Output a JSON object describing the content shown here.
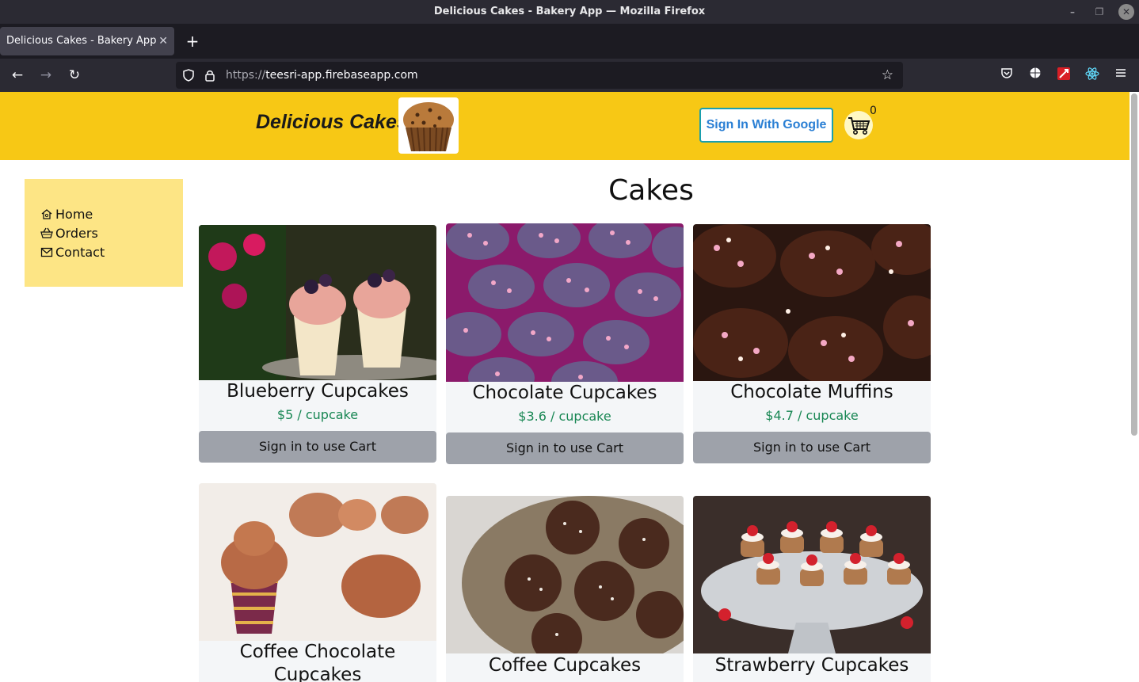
{
  "window": {
    "title": "Delicious Cakes - Bakery App — Mozilla Firefox",
    "minimize": "–",
    "restore": "❐",
    "close": "✕"
  },
  "tabs": [
    {
      "label": "Delicious Cakes - Bakery App",
      "close": "✕"
    }
  ],
  "new_tab": "+",
  "nav": {
    "back": "←",
    "forward": "→",
    "reload": "↻",
    "shield": "⛉",
    "lock": "🔒",
    "url_scheme": "https://",
    "url_host": "teesri-app.firebaseapp.com",
    "bookmark": "☆"
  },
  "toolbar": {
    "pocket": "◡",
    "globe": "◍",
    "ext1": "✦",
    "react": "⚛",
    "menu": "≡"
  },
  "header": {
    "brand": "Delicious Cakes",
    "signin_label": "Sign In With Google",
    "cart_count": "0"
  },
  "sidebar": {
    "items": [
      {
        "label": "Home",
        "icon": "home-icon"
      },
      {
        "label": "Orders",
        "icon": "basket-icon"
      },
      {
        "label": "Contact",
        "icon": "envelope-icon"
      }
    ]
  },
  "main": {
    "title": "Cakes",
    "products": [
      {
        "name": "Blueberry Cupcakes",
        "price": "$5 / cupcake",
        "button": "Sign in to use Cart"
      },
      {
        "name": "Chocolate Cupcakes",
        "price": "$3.6 / cupcake",
        "button": "Sign in to use Cart"
      },
      {
        "name": "Chocolate Muffins",
        "price": "$4.7 / cupcake",
        "button": "Sign in to use Cart"
      },
      {
        "name": "Coffee Chocolate",
        "name2": "Cupcakes"
      },
      {
        "name": "Coffee Cupcakes"
      },
      {
        "name": "Strawberry Cupcakes"
      }
    ]
  },
  "colors": {
    "header_bg": "#f7c815",
    "sidebar_bg": "#fde585",
    "price": "#198754",
    "cart_button": "#9ea2aa",
    "signin_border": "#1a9fae"
  }
}
